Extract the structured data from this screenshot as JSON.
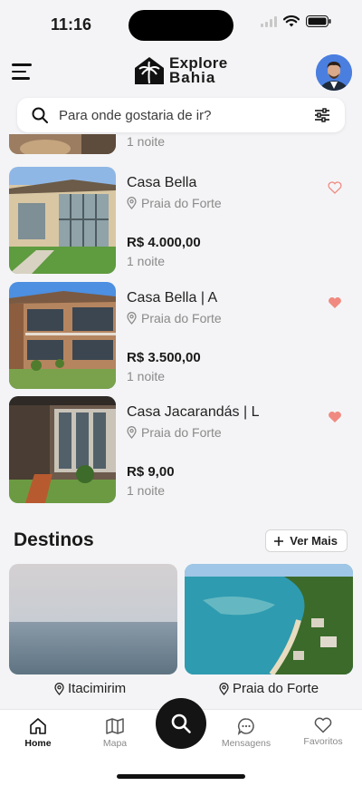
{
  "status_bar": {
    "time": "11:16"
  },
  "header": {
    "logo_line1": "Explore",
    "logo_line2": "Bahia"
  },
  "search": {
    "placeholder": "Para onde gostaria de ir?"
  },
  "listings": [
    {
      "title": "",
      "location": "",
      "price": "",
      "nights": "1 noite",
      "favorited": false
    },
    {
      "title": "Casa Bella",
      "location": "Praia do Forte",
      "price": "R$ 4.000,00",
      "nights": "1 noite",
      "favorited": false
    },
    {
      "title": "Casa Bella | A",
      "location": "Praia do Forte",
      "price": "R$ 3.500,00",
      "nights": "1 noite",
      "favorited": true
    },
    {
      "title": "Casa Jacarandás | L",
      "location": "Praia do Forte",
      "price": "R$ 9,00",
      "nights": "1 noite",
      "favorited": true
    }
  ],
  "destinos": {
    "title": "Destinos",
    "ver_mais": "Ver Mais",
    "items": [
      {
        "name": "Itacimirim"
      },
      {
        "name": "Praia do Forte"
      }
    ]
  },
  "tabbar": {
    "home": "Home",
    "mapa": "Mapa",
    "mensagens": "Mensagens",
    "favoritos": "Favoritos"
  },
  "colors": {
    "heart": "#f08a80",
    "accent": "#141414"
  }
}
